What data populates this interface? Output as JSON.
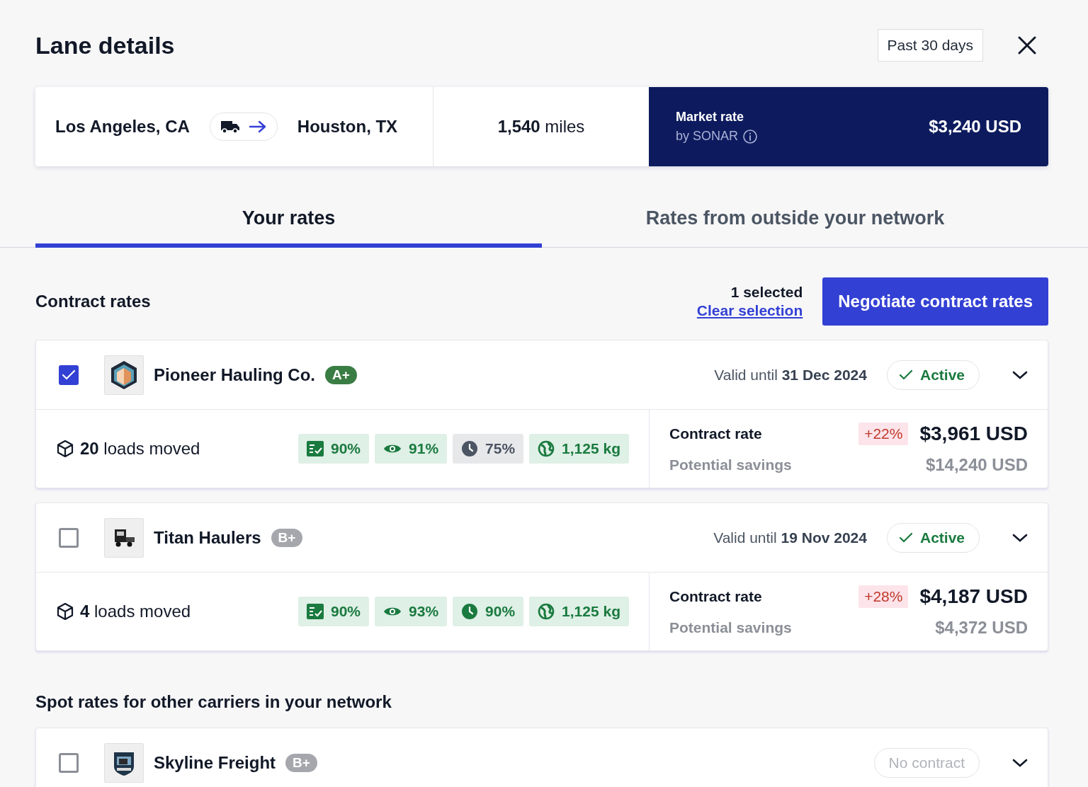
{
  "header": {
    "title": "Lane details",
    "period": "Past 30 days"
  },
  "lane": {
    "origin": "Los Angeles, CA",
    "destination": "Houston, TX",
    "distance": "**1,540** miles",
    "market": {
      "label": "Market rate",
      "source": "by SONAR",
      "value": "$3,240 USD"
    }
  },
  "tabs": [
    {
      "label": "Your rates",
      "selected": true
    },
    {
      "label": "Rates from outside your network",
      "selected": false
    }
  ],
  "contract_section": {
    "title": "Contract rates",
    "selection_count": "1 selected",
    "clear_link": "Clear selection",
    "action": "Negotiate contract rates"
  },
  "carriers": [
    {
      "checked": true,
      "logo": {
        "kind": "hexagon"
      },
      "name": "Pioneer Hauling Co.",
      "grade": {
        "label": "A+",
        "color": "#3a7d44"
      },
      "valid": "Valid until **31 Dec 2024**",
      "status": {
        "kind": "active",
        "label": "Active"
      },
      "loads": "**20** loads moved",
      "chips": [
        {
          "kind": "checklist",
          "label": "90%",
          "positive": true
        },
        {
          "kind": "eye",
          "label": "91%",
          "positive": true
        },
        {
          "kind": "clock",
          "label": "75%",
          "positive": false
        },
        {
          "kind": "globe",
          "label": "1,125 kg",
          "positive": true
        }
      ],
      "rate_label": "Contract rate",
      "change": "+22%",
      "rate": "$3,961 USD",
      "savings_label": "Potential savings",
      "savings": "$14,240 USD"
    },
    {
      "checked": false,
      "logo": {
        "kind": "truck"
      },
      "name": "Titan Haulers",
      "grade": {
        "label": "B+",
        "color": "#a5a7ad"
      },
      "valid": "Valid until **19 Nov 2024**",
      "status": {
        "kind": "active",
        "label": "Active"
      },
      "loads": "**4** loads moved",
      "chips": [
        {
          "kind": "checklist",
          "label": "90%",
          "positive": true
        },
        {
          "kind": "eye",
          "label": "93%",
          "positive": true
        },
        {
          "kind": "clock",
          "label": "90%",
          "positive": true
        },
        {
          "kind": "globe",
          "label": "1,125 kg",
          "positive": true
        }
      ],
      "rate_label": "Contract rate",
      "change": "+28%",
      "rate": "$4,187 USD",
      "savings_label": "Potential savings",
      "savings": "$4,372 USD"
    }
  ],
  "spot_section": {
    "title": "Spot rates for other carriers in your network"
  },
  "spot_carriers": [
    {
      "checked": false,
      "logo": {
        "kind": "badge"
      },
      "name": "Skyline Freight",
      "grade": {
        "label": "B+",
        "color": "#a5a7ad"
      },
      "status": {
        "kind": "none",
        "label": "No contract"
      }
    }
  ]
}
